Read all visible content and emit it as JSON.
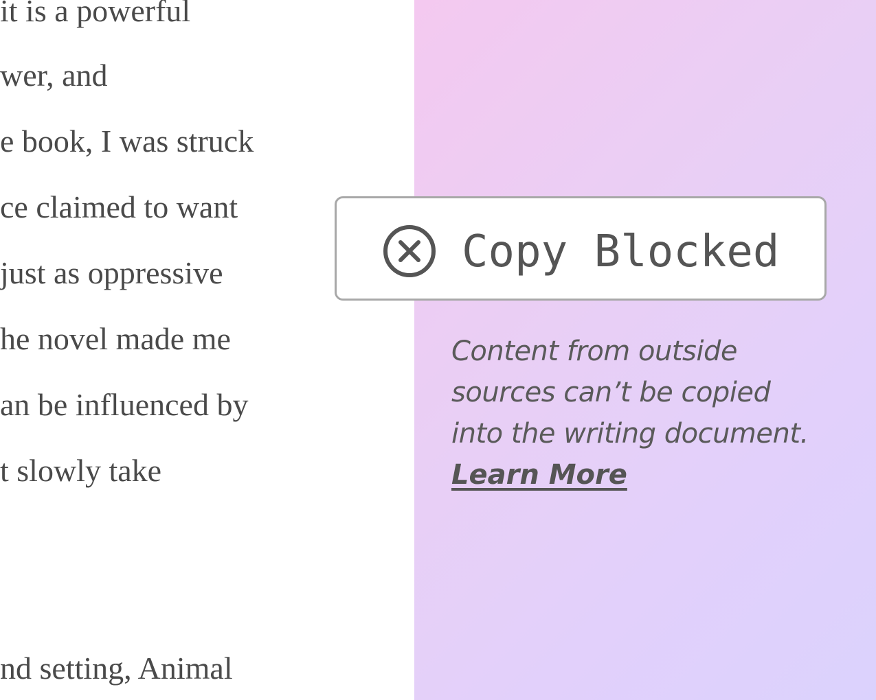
{
  "document": {
    "lines": [
      "it is a powerful",
      "wer, and",
      "e book, I was struck",
      "ce claimed to want",
      " just as oppressive",
      "he novel made me",
      "an be influenced by",
      "t slowly take",
      "nd setting, Animal"
    ]
  },
  "copy_block": {
    "icon": "circle-x-icon",
    "title": "Copy Blocked",
    "message": "Content from outside sources can’t be copied into the writing document.",
    "learn_more_label": "Learn More"
  },
  "colors": {
    "panel_gradient_start": "#f4c9f0",
    "panel_gradient_end": "#dbd2fd",
    "text": "#555555",
    "card_border": "#a8a8a8"
  }
}
